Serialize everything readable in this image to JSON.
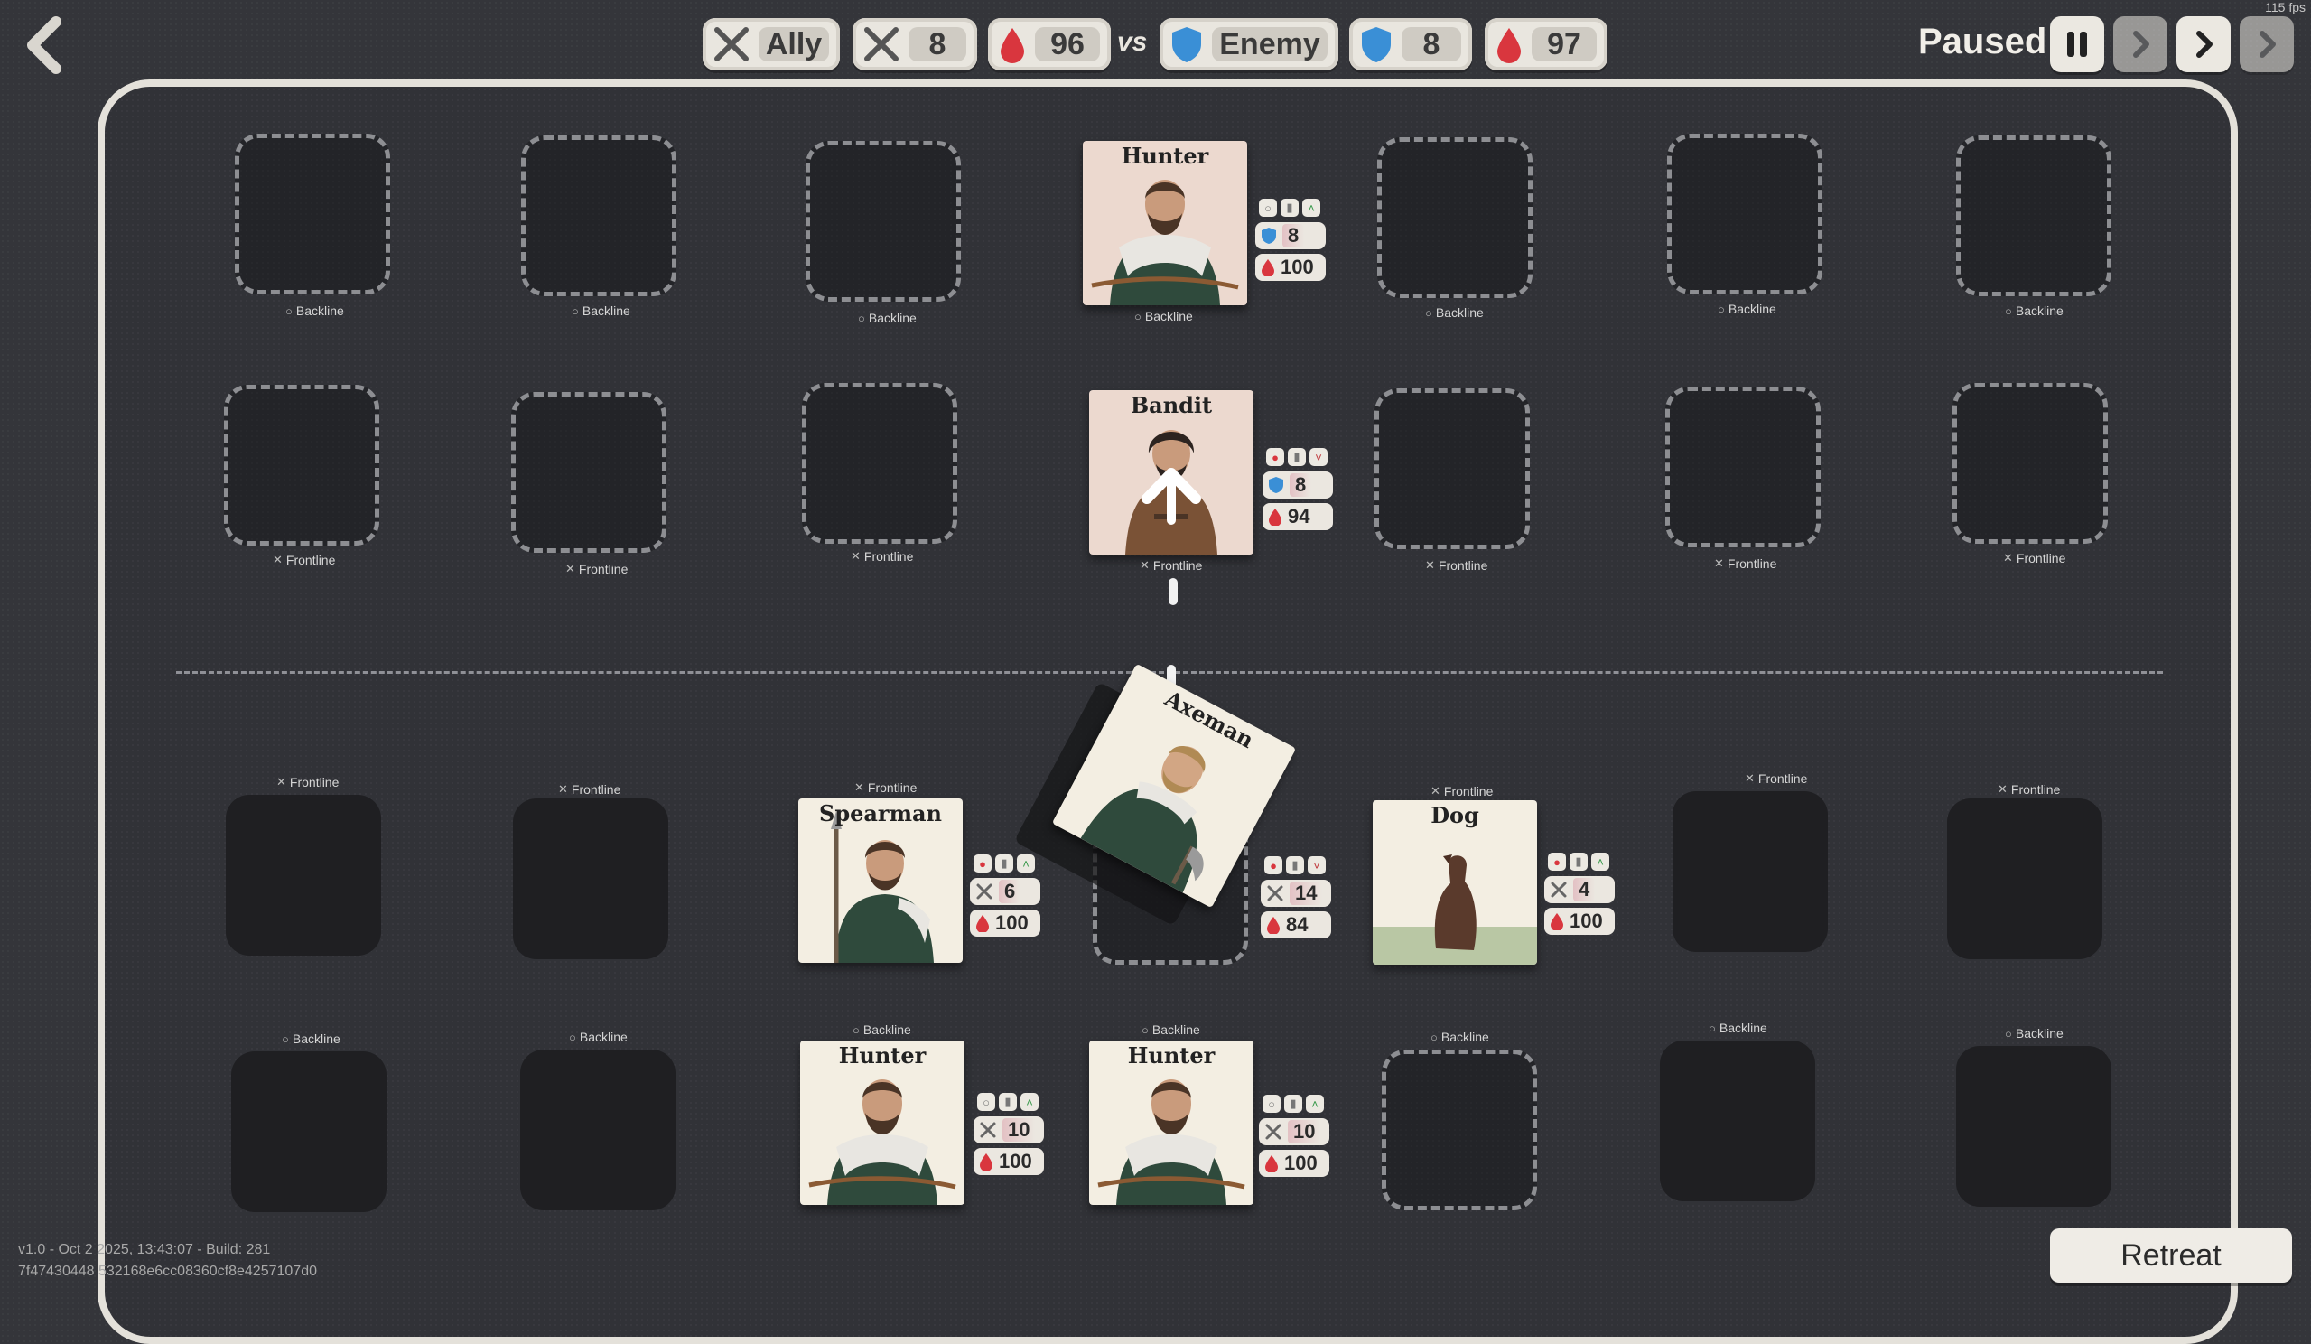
{
  "fps": "115 fps",
  "header": {
    "ally_label": "Ally",
    "ally_attack": "8",
    "ally_health": "96",
    "vs": "vs",
    "enemy_label": "Enemy",
    "enemy_armor": "8",
    "enemy_health": "97"
  },
  "controls": {
    "status": "Paused"
  },
  "lanes": {
    "backline": "Backline",
    "frontline": "Frontline"
  },
  "units": {
    "enemy_hunter": {
      "name": "Hunter",
      "armor": "8",
      "health": "100"
    },
    "enemy_bandit": {
      "name": "Bandit",
      "armor": "8",
      "health": "94"
    },
    "ally_axeman": {
      "name": "Axeman",
      "attack": "14",
      "health": "84"
    },
    "ally_spearman": {
      "name": "Spearman",
      "attack": "6",
      "health": "100"
    },
    "ally_dog": {
      "name": "Dog",
      "attack": "4",
      "health": "100"
    },
    "ally_hunter_1": {
      "name": "Hunter",
      "attack": "10",
      "health": "100"
    },
    "ally_hunter_2": {
      "name": "Hunter",
      "attack": "10",
      "health": "100"
    }
  },
  "retreat_label": "Retreat",
  "version": {
    "line1": "v1.0 - Oct 2 2025, 13:43:07 - Build: 281",
    "line2": "7f47430448 532168e6cc08360cf8e4257107d0"
  },
  "colors": {
    "background": "#34353a",
    "board_border": "#e4e1da",
    "health": "#d9363e",
    "armor": "#3a8fd6"
  }
}
